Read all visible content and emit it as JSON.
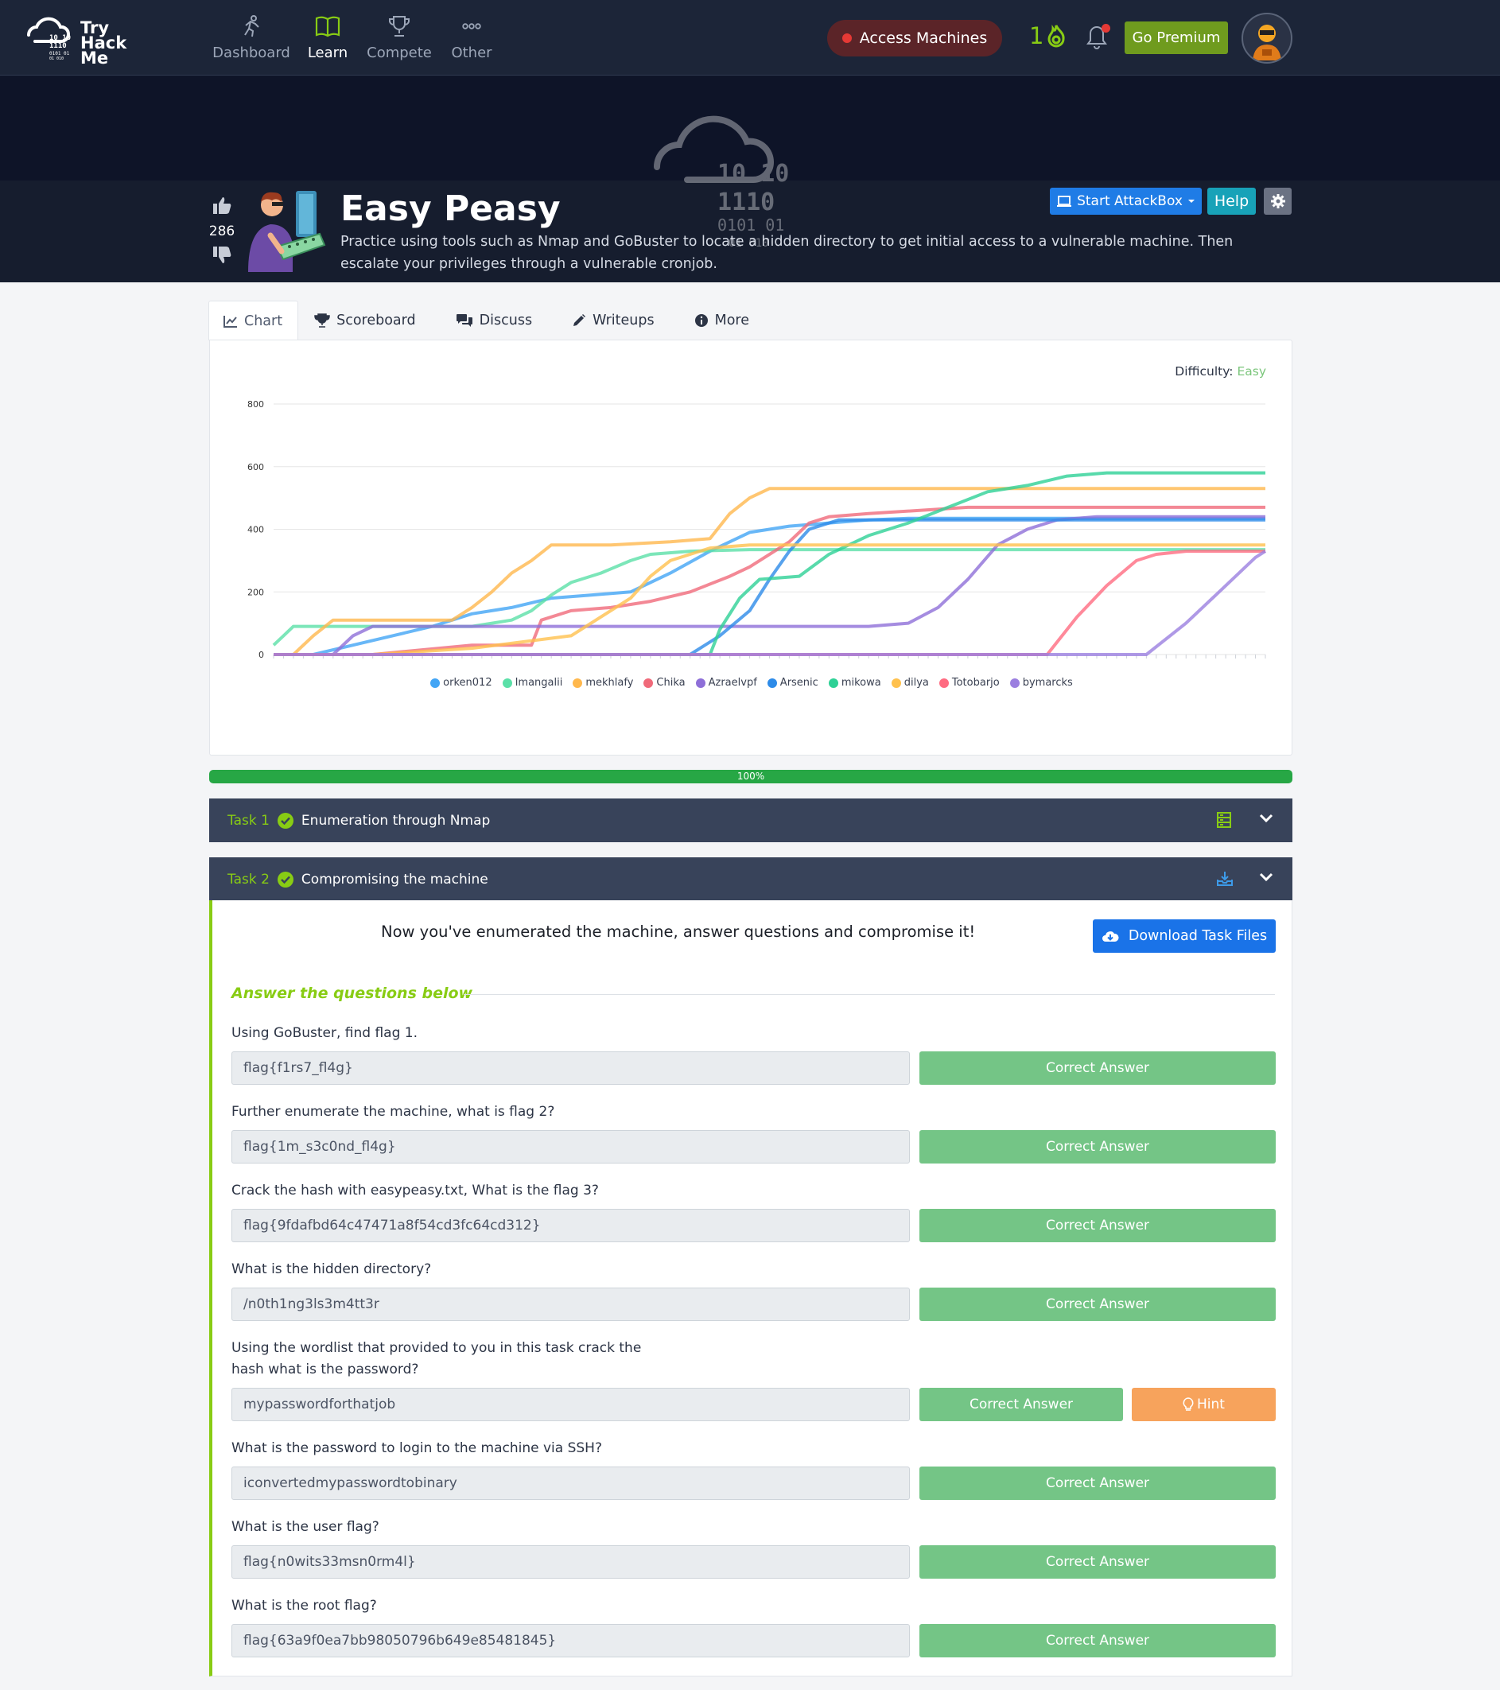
{
  "nav": {
    "logo_text": [
      "Try",
      "Hack",
      "Me"
    ],
    "items": [
      {
        "label": "Dashboard",
        "icon": "runner-icon"
      },
      {
        "label": "Learn",
        "icon": "book-icon"
      },
      {
        "label": "Compete",
        "icon": "trophy-icon"
      },
      {
        "label": "Other",
        "icon": "dots-icon"
      }
    ],
    "access_machines": "Access Machines",
    "streak": "1",
    "premium": "Go Premium",
    "colors": {
      "bg": "#1c2538",
      "accent": "#88cc14"
    }
  },
  "room": {
    "votes": "286",
    "title": "Easy Peasy",
    "description": "Practice using tools such as Nmap and GoBuster to locate a hidden directory to get initial access to a vulnerable machine. Then escalate your privileges through a vulnerable cronjob.",
    "attackbox": "Start AttackBox",
    "help": "Help"
  },
  "tabs": [
    "Chart",
    "Scoreboard",
    "Discuss",
    "Writeups",
    "More"
  ],
  "difficulty": {
    "label": "Difficulty:",
    "value": "Easy"
  },
  "progress": {
    "value": 100,
    "label": "100%"
  },
  "chart_data": {
    "type": "line",
    "ylim": [
      0,
      800
    ],
    "yticks": [
      0,
      200,
      400,
      600,
      800
    ],
    "grid": true,
    "legend_position": "bottom",
    "series": [
      {
        "name": "orken012",
        "color": "#42a5f5",
        "values": [
          [
            0,
            0
          ],
          [
            40,
            0
          ],
          [
            80,
            30
          ],
          [
            120,
            60
          ],
          [
            160,
            90
          ],
          [
            200,
            130
          ],
          [
            240,
            150
          ],
          [
            280,
            180
          ],
          [
            320,
            190
          ],
          [
            360,
            200
          ],
          [
            400,
            260
          ],
          [
            440,
            330
          ],
          [
            480,
            390
          ],
          [
            520,
            410
          ],
          [
            560,
            420
          ],
          [
            600,
            430
          ],
          [
            640,
            435
          ],
          [
            680,
            435
          ],
          [
            720,
            435
          ],
          [
            760,
            435
          ],
          [
            800,
            435
          ],
          [
            850,
            435
          ],
          [
            900,
            435
          ],
          [
            950,
            435
          ],
          [
            1000,
            435
          ]
        ]
      },
      {
        "name": "Imangalii",
        "color": "#5be0a8",
        "values": [
          [
            0,
            30
          ],
          [
            10,
            60
          ],
          [
            20,
            90
          ],
          [
            60,
            90
          ],
          [
            120,
            90
          ],
          [
            200,
            90
          ],
          [
            240,
            110
          ],
          [
            260,
            140
          ],
          [
            280,
            190
          ],
          [
            300,
            230
          ],
          [
            330,
            260
          ],
          [
            360,
            300
          ],
          [
            380,
            320
          ],
          [
            420,
            330
          ],
          [
            480,
            335
          ],
          [
            600,
            335
          ],
          [
            800,
            335
          ],
          [
            1000,
            335
          ]
        ]
      },
      {
        "name": "mekhlafy",
        "color": "#ffb84d",
        "values": [
          [
            0,
            0
          ],
          [
            20,
            0
          ],
          [
            40,
            60
          ],
          [
            60,
            110
          ],
          [
            120,
            110
          ],
          [
            180,
            110
          ],
          [
            200,
            150
          ],
          [
            220,
            200
          ],
          [
            240,
            260
          ],
          [
            260,
            300
          ],
          [
            280,
            350
          ],
          [
            340,
            350
          ],
          [
            400,
            360
          ],
          [
            440,
            370
          ],
          [
            460,
            450
          ],
          [
            480,
            500
          ],
          [
            500,
            530
          ],
          [
            560,
            530
          ],
          [
            700,
            530
          ],
          [
            1000,
            530
          ]
        ]
      },
      {
        "name": "Chika",
        "color": "#f06a7a",
        "values": [
          [
            0,
            0
          ],
          [
            100,
            0
          ],
          [
            200,
            30
          ],
          [
            260,
            30
          ],
          [
            270,
            110
          ],
          [
            300,
            140
          ],
          [
            340,
            150
          ],
          [
            380,
            170
          ],
          [
            420,
            200
          ],
          [
            460,
            250
          ],
          [
            480,
            280
          ],
          [
            520,
            360
          ],
          [
            540,
            420
          ],
          [
            560,
            440
          ],
          [
            600,
            450
          ],
          [
            700,
            470
          ],
          [
            800,
            470
          ],
          [
            1000,
            470
          ]
        ]
      },
      {
        "name": "Azraelvpf",
        "color": "#8e6fd8",
        "values": [
          [
            0,
            0
          ],
          [
            60,
            0
          ],
          [
            80,
            60
          ],
          [
            100,
            90
          ],
          [
            200,
            90
          ],
          [
            300,
            90
          ],
          [
            400,
            90
          ],
          [
            500,
            90
          ],
          [
            600,
            90
          ],
          [
            640,
            100
          ],
          [
            670,
            150
          ],
          [
            700,
            240
          ],
          [
            730,
            350
          ],
          [
            760,
            400
          ],
          [
            790,
            430
          ],
          [
            830,
            440
          ],
          [
            900,
            440
          ],
          [
            1000,
            440
          ]
        ]
      },
      {
        "name": "Arsenic",
        "color": "#2d8be8",
        "values": [
          [
            0,
            0
          ],
          [
            200,
            0
          ],
          [
            420,
            0
          ],
          [
            450,
            60
          ],
          [
            480,
            140
          ],
          [
            500,
            240
          ],
          [
            520,
            330
          ],
          [
            540,
            400
          ],
          [
            570,
            430
          ],
          [
            600,
            430
          ],
          [
            700,
            430
          ],
          [
            800,
            430
          ],
          [
            1000,
            430
          ]
        ]
      },
      {
        "name": "mikowa",
        "color": "#2ed196",
        "values": [
          [
            0,
            0
          ],
          [
            440,
            0
          ],
          [
            450,
            80
          ],
          [
            470,
            180
          ],
          [
            490,
            240
          ],
          [
            530,
            250
          ],
          [
            560,
            320
          ],
          [
            600,
            380
          ],
          [
            640,
            420
          ],
          [
            680,
            470
          ],
          [
            720,
            520
          ],
          [
            760,
            540
          ],
          [
            800,
            570
          ],
          [
            840,
            580
          ],
          [
            900,
            580
          ],
          [
            1000,
            580
          ]
        ]
      },
      {
        "name": "dilya",
        "color": "#ffc14d",
        "values": [
          [
            0,
            0
          ],
          [
            100,
            0
          ],
          [
            200,
            20
          ],
          [
            300,
            60
          ],
          [
            360,
            180
          ],
          [
            380,
            250
          ],
          [
            400,
            300
          ],
          [
            420,
            320
          ],
          [
            440,
            340
          ],
          [
            480,
            350
          ],
          [
            600,
            350
          ],
          [
            800,
            350
          ],
          [
            1000,
            350
          ]
        ]
      },
      {
        "name": "Totobarjo",
        "color": "#ff6b81",
        "values": [
          [
            0,
            0
          ],
          [
            600,
            0
          ],
          [
            780,
            0
          ],
          [
            810,
            120
          ],
          [
            840,
            220
          ],
          [
            870,
            300
          ],
          [
            890,
            320
          ],
          [
            920,
            330
          ],
          [
            1000,
            330
          ]
        ]
      },
      {
        "name": "bymarcks",
        "color": "#9b7fe0",
        "values": [
          [
            0,
            0
          ],
          [
            700,
            0
          ],
          [
            880,
            0
          ],
          [
            920,
            100
          ],
          [
            960,
            220
          ],
          [
            990,
            310
          ],
          [
            1000,
            330
          ]
        ]
      }
    ]
  },
  "tasks": [
    {
      "num": "Task 1",
      "title": "Enumeration through Nmap"
    },
    {
      "num": "Task 2",
      "title": "Compromising the machine"
    }
  ],
  "task2": {
    "intro": "Now you've enumerated the machine, answer questions and compromise it!",
    "download": "Download Task Files",
    "answer_heading": "Answer the questions below",
    "correct_label": "Correct Answer",
    "hint_label": "Hint",
    "questions": [
      {
        "q": "Using GoBuster, find flag 1.",
        "a": "flag{f1rs7_fl4g}"
      },
      {
        "q": "Further enumerate the machine, what is flag 2?",
        "a": "flag{1m_s3c0nd_fl4g}"
      },
      {
        "q": "Crack the hash with easypeasy.txt, What is the flag 3?",
        "a": "flag{9fdafbd64c47471a8f54cd3fc64cd312}"
      },
      {
        "q": "What is the hidden directory?",
        "a": "/n0th1ng3ls3m4tt3r"
      },
      {
        "q": "Using the wordlist that provided to you in this task crack the hash what is the password?",
        "a": "mypasswordforthatjob"
      },
      {
        "q": "What is the password to login to the machine via SSH?",
        "a": "iconvertedmypasswordtobinary"
      },
      {
        "q": "What is the user flag?",
        "a": "flag{n0wits33msn0rm4l}"
      },
      {
        "q": "What is the root flag?",
        "a": "flag{63a9f0ea7bb98050796b649e85481845}"
      }
    ]
  }
}
